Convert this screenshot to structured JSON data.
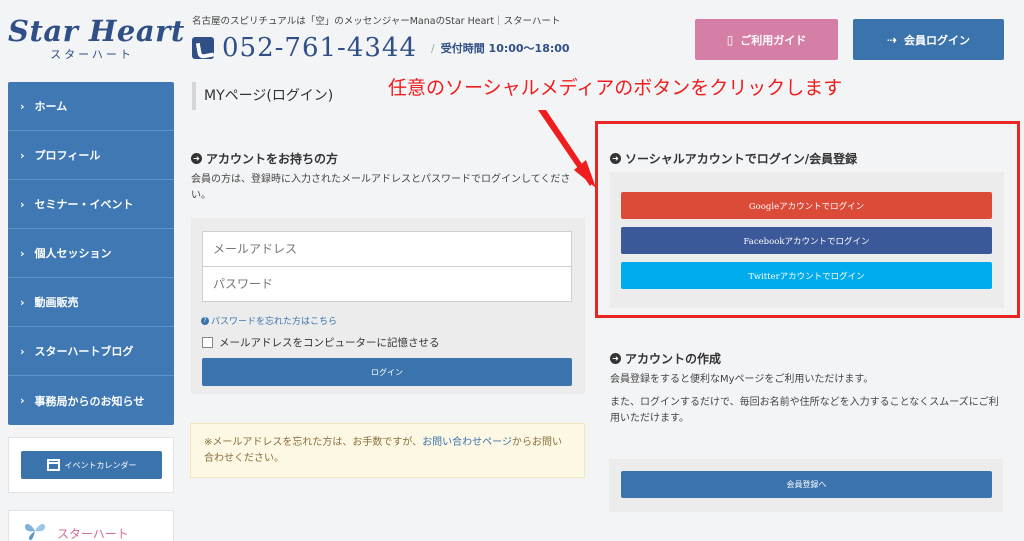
{
  "header": {
    "logo_main": "Star Heart",
    "logo_sub": "スターハート",
    "tagline": "名古屋のスピリチュアルは「空」のメッセンジャーManaのStar Heart｜スターハート",
    "phone_number": "052-761-4344",
    "hours_sep": "/",
    "hours": "受付時間 10:00～18:00",
    "guide_button": "ご利用ガイド",
    "login_button": "会員ログイン"
  },
  "sidebar": {
    "items": [
      {
        "label": "ホーム"
      },
      {
        "label": "プロフィール"
      },
      {
        "label": "セミナー・イベント"
      },
      {
        "label": "個人セッション"
      },
      {
        "label": "動画販売"
      },
      {
        "label": "スターハートブログ"
      },
      {
        "label": "事務局からのお知らせ"
      }
    ],
    "calendar_button": "イベントカレンダー",
    "bottom_label": "スターハート"
  },
  "main": {
    "page_title": "MYページ(ログイン)",
    "annotation": "任意のソーシャルメディアのボタンをクリックします",
    "account": {
      "title": "アカウントをお持ちの方",
      "description": "会員の方は、登録時に入力されたメールアドレスとパスワードでログインしてください。",
      "email_placeholder": "メールアドレス",
      "password_placeholder": "パスワード",
      "forgot_link": "パスワードを忘れた方はこちら",
      "remember_label": "メールアドレスをコンピューターに記憶させる",
      "login_button": "ログイン"
    },
    "notice": {
      "before": "※メールアドレスを忘れた方は、お手数ですが、",
      "link": "お問い合わせページ",
      "after": "からお問い合わせください。"
    },
    "social": {
      "title": "ソーシャルアカウントでログイン/会員登録",
      "google": "Googleアカウントでログイン",
      "facebook": "Facebookアカウントでログイン",
      "twitter": "Twitterアカウントでログイン"
    },
    "create": {
      "title": "アカウントの作成",
      "para1": "会員登録をすると便利なMyページをご利用いただけます。",
      "para2": "また、ログインするだけで、毎回お名前や住所などを入力することなくスムーズにご利用いただけます。",
      "button": "会員登録へ"
    }
  },
  "colors": {
    "brand": "#2f4f86",
    "primary_button": "#3b73ad",
    "guide_pink": "#d57fa6",
    "google": "#dc4a38",
    "facebook": "#3b5998",
    "twitter": "#00aced",
    "annotation_red": "#ef1d1d"
  },
  "icons": {
    "phone": "phone-icon",
    "guide": "book-icon",
    "login": "sign-in-icon",
    "nav": "chevron-right-icon",
    "calendar": "calendar-icon",
    "section": "circle-arrow-right-icon",
    "help": "question-circle-icon"
  }
}
